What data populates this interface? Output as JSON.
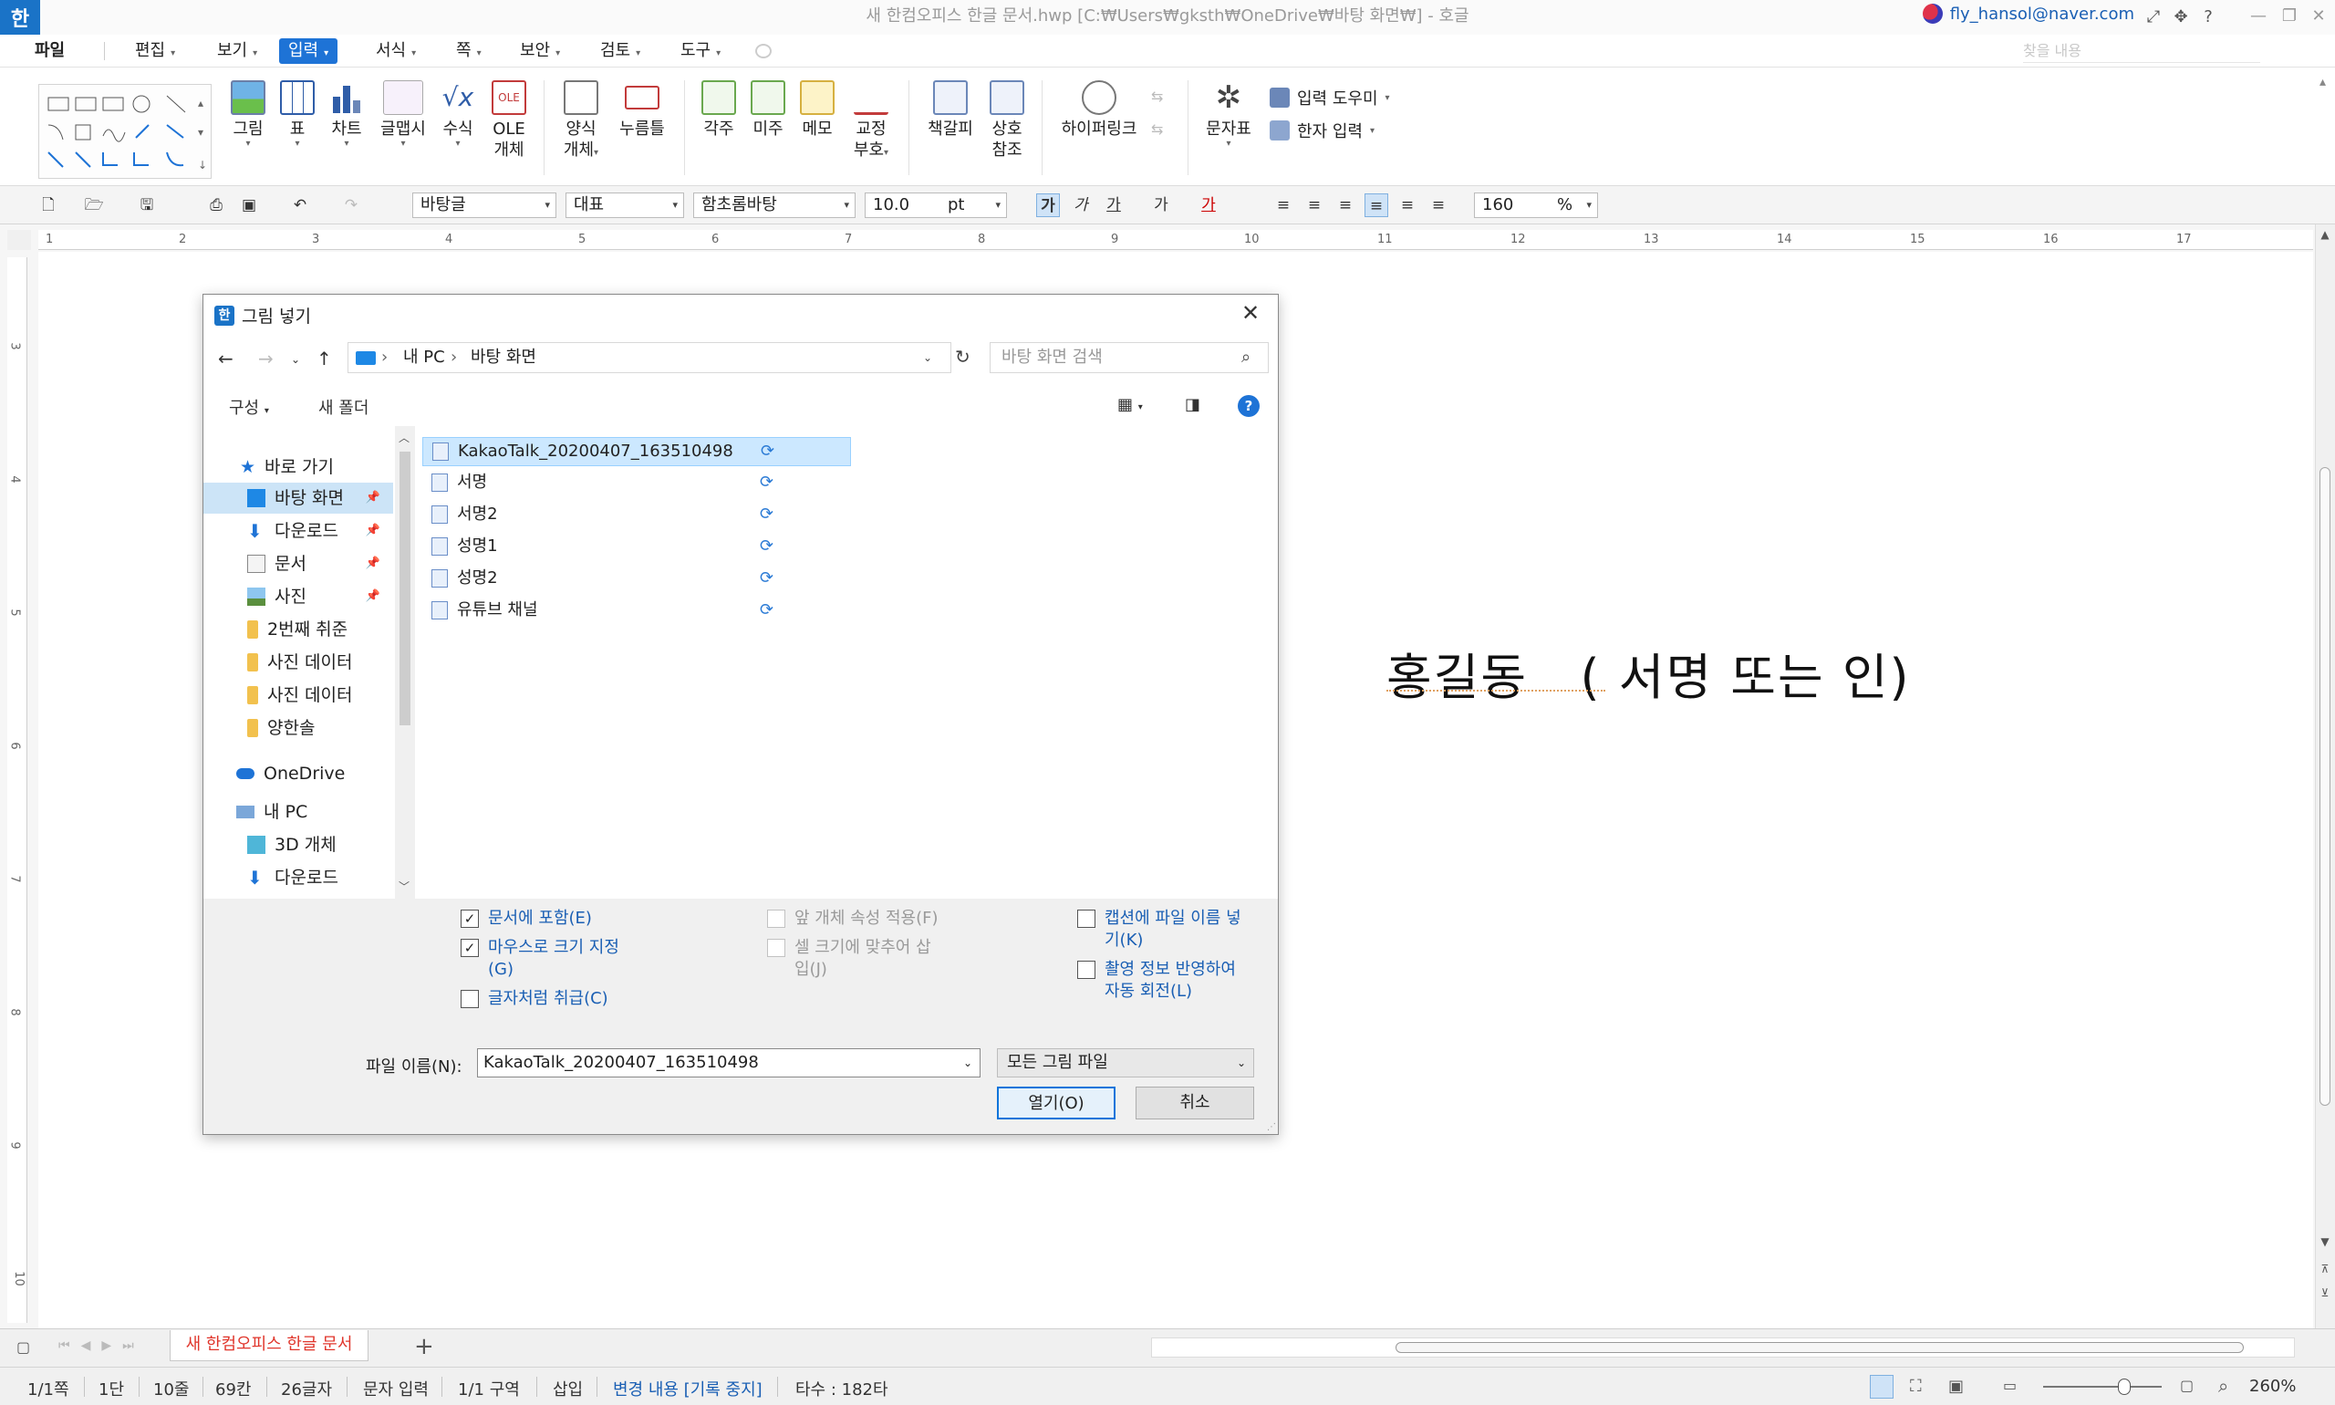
{
  "window": {
    "app_icon": "한",
    "title": "새 한컴오피스 한글 문서.hwp [C:₩Users₩gksth₩OneDrive₩바탕 화면₩] - 호글",
    "user": "fly_hansol@naver.com",
    "icons": [
      "fullscreen-icon",
      "move-icon",
      "help-icon"
    ],
    "controls": [
      "minimize",
      "restore",
      "close"
    ]
  },
  "menu": {
    "file": "파일",
    "items": [
      "편집",
      "보기",
      "입력",
      "서식",
      "쪽",
      "보안",
      "검토",
      "도구"
    ],
    "active": "입력",
    "search_placeholder": "찾을 내용"
  },
  "ribbon": {
    "image": "그림",
    "table": "표",
    "chart": "차트",
    "textart": "글맵시",
    "equation": "수식",
    "ole1": "OLE",
    "ole2": "개체",
    "form1": "양식",
    "form2": "개체",
    "button": "누름틀",
    "footnote": "각주",
    "endnote": "미주",
    "memo": "메모",
    "proof1": "교정",
    "proof2": "부호",
    "bookmark": "책갈피",
    "xref1": "상호",
    "xref2": "참조",
    "hyperlink": "하이퍼링크",
    "charmap": "문자표",
    "input_helper": "입력 도우미",
    "hanja_input": "한자 입력",
    "ole_icon_text": "OLE"
  },
  "format": {
    "style": "바탕글",
    "lang": "대표",
    "font": "함초롬바탕",
    "size": "10.0",
    "unit": "pt",
    "line_spacing": "160",
    "percent": "%"
  },
  "ruler": {
    "h_ticks": [
      "1",
      "2",
      "3",
      "4",
      "5",
      "6",
      "7",
      "8",
      "9",
      "10",
      "11",
      "12",
      "13",
      "14",
      "15",
      "16",
      "17"
    ],
    "v_ticks": [
      "3",
      "4",
      "5",
      "6",
      "7",
      "8",
      "9",
      "10"
    ]
  },
  "document": {
    "text": "홍길동   ( 서명 또는 인)"
  },
  "dialog": {
    "icon": "한",
    "title": "그림 넣기",
    "address": [
      "내 PC",
      "바탕 화면"
    ],
    "search_placeholder": "바탕 화면 검색",
    "toolbar": {
      "organize": "구성",
      "new_folder": "새 폴더"
    },
    "nav": {
      "quick_access": "바로 가기",
      "items": [
        {
          "label": "바탕 화면",
          "icon": "desktop-icon"
        },
        {
          "label": "다운로드",
          "icon": "download-icon"
        },
        {
          "label": "문서",
          "icon": "document-icon"
        },
        {
          "label": "사진",
          "icon": "pictures-icon"
        },
        {
          "label": "2번째 취준",
          "icon": "folder-icon"
        },
        {
          "label": "사진 데이터",
          "icon": "folder-icon"
        },
        {
          "label": "사진 데이터",
          "icon": "folder-icon"
        },
        {
          "label": "양한솔",
          "icon": "folder-icon"
        }
      ],
      "onedrive": "OneDrive",
      "this_pc": "내 PC",
      "pc_items": [
        "3D 개체",
        "다운로드"
      ]
    },
    "files": [
      "KakaoTalk_20200407_163510498",
      "서명",
      "서명2",
      "성명1",
      "성명2",
      "유튜브 채널"
    ],
    "selected_file": "KakaoTalk_20200407_163510498",
    "options": {
      "include_doc": "문서에 포함(E)",
      "mouse_size1": "마우스로 크기 지정",
      "mouse_size2": "(G)",
      "treat_as_char": "글자처럼 취급(C)",
      "apply_prev": "앞 개체 속성 적용(F)",
      "fit_cell1": "셀 크기에 맞추어 삽",
      "fit_cell2": "입(J)",
      "caption1": "캡션에 파일 이름 넣",
      "caption2": "기(K)",
      "rotate1": "촬영 정보 반영하여",
      "rotate2": "자동 회전(L)"
    },
    "filename_label": "파일 이름(N):",
    "filename_value": "KakaoTalk_20200407_163510498",
    "filetype": "모든 그림 파일",
    "open": "열기(O)",
    "cancel": "취소"
  },
  "tabs": {
    "doc_tab": "새 한컴오피스 한글 문서",
    "add": "+"
  },
  "status": {
    "page": "1/1쪽",
    "col": "1단",
    "line": "10줄",
    "char": "69칸",
    "count": "26글자",
    "input": "문자 입력",
    "section": "1/1 구역",
    "insert": "삽입",
    "changes": "변경 내용 [기록 중지]",
    "keystrokes": "타수 : 182타",
    "zoom": "260%"
  },
  "colors": {
    "accent": "#1e73d6",
    "tab_text": "#e0352b",
    "link": "#1a5fb4"
  }
}
